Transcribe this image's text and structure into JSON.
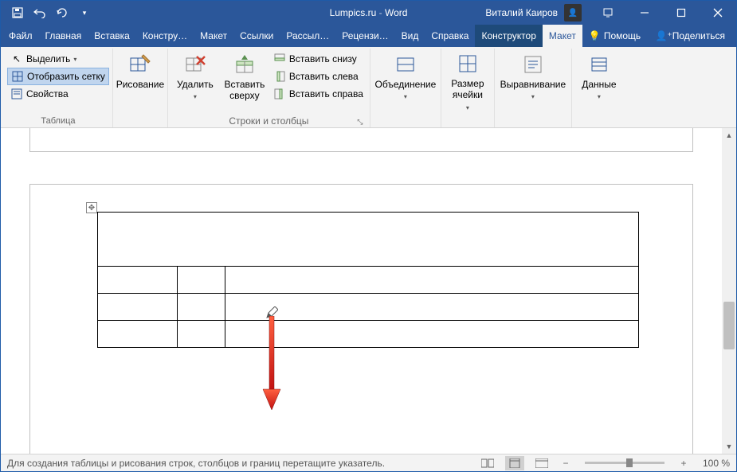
{
  "window": {
    "title_doc": "Lumpics.ru",
    "title_app": "Word",
    "user_name": "Виталий Каиров"
  },
  "tabs": {
    "file": "Файл",
    "home": "Главная",
    "insert": "Вставка",
    "design": "Констру…",
    "layout": "Макет",
    "references": "Ссылки",
    "mailings": "Рассыл…",
    "review": "Рецензи…",
    "view": "Вид",
    "help": "Справка",
    "table_design": "Конструктор",
    "table_layout": "Макет",
    "tell_me": "Помощь",
    "share": "Поделиться"
  },
  "ribbon": {
    "table_group": "Таблица",
    "select": "Выделить",
    "view_gridlines": "Отобразить сетку",
    "properties": "Свойства",
    "draw": "Рисование",
    "delete": "Удалить",
    "insert_above": "Вставить сверху",
    "insert_below": "Вставить снизу",
    "insert_left": "Вставить слева",
    "insert_right": "Вставить справа",
    "rows_cols_group": "Строки и столбцы",
    "merge": "Объединение",
    "cell_size": "Размер ячейки",
    "alignment": "Выравнивание",
    "data": "Данные"
  },
  "statusbar": {
    "hint": "Для создания таблицы и рисования строк, столбцов и границ перетащите указатель.",
    "zoom": "100 %"
  }
}
